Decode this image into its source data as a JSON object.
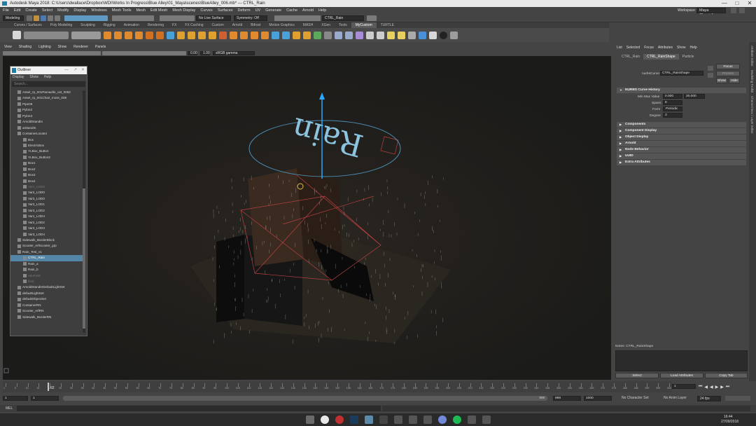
{
  "titlebar": {
    "title": "Autodesk Maya 2018: C:\\Users\\dwallace\\Dropbox\\WDI\\Works In Progress\\Blue Alley\\01_Maya\\scenes\\BlueAlley_006.mb* --- CTRL_Rain",
    "minimize": "—",
    "maximize": "□",
    "close": "✕"
  },
  "menubar": [
    "File",
    "Edit",
    "Create",
    "Select",
    "Modify",
    "Display",
    "Windows",
    "Mesh Tools",
    "Mesh",
    "Edit Mesh",
    "Mesh Display",
    "Curves",
    "Surfaces",
    "Deform",
    "UV",
    "Generate",
    "Cache",
    "Arnold",
    "Help"
  ],
  "workspace": {
    "label": "Workspace :",
    "value": "Maya Classic*"
  },
  "statusline": {
    "mode": "Modeling",
    "live_surface": "No Live Surface",
    "symmetry": "Symmetry: Off",
    "object_field": "CTRL_Rain"
  },
  "shelf_tabs": [
    "Curves / Surfaces",
    "Poly Modeling",
    "Sculpting",
    "Rigging",
    "Animation",
    "Rendering",
    "FX",
    "FX Caching",
    "Custom",
    "Arnold",
    "Bifrost",
    "Motion Graphics",
    "MASH",
    "XGen",
    "Tools",
    "MyCustom",
    "TURTLE"
  ],
  "shelf_active": "MyCustom",
  "panel_menu": [
    "View",
    "Shading",
    "Lighting",
    "Show",
    "Renderer",
    "Panels"
  ],
  "panel_icons": {
    "value1": "0.00",
    "value2": "1.00",
    "colorspace": "sRGB gamma"
  },
  "outliner": {
    "title": "Outliner",
    "menu": [
      "Display",
      "Show",
      "Help"
    ],
    "search_placeholder": "Search...",
    "items": [
      {
        "label": "Asset_rp_001Pamaelle_ost_0082",
        "indent": 1,
        "state": "normal"
      },
      {
        "label": "Asset_rp_001Chair_moss_008",
        "indent": 1,
        "state": "normal"
      },
      {
        "label": "Pipe06",
        "indent": 1,
        "state": "normal"
      },
      {
        "label": "Pylon2",
        "indent": 1,
        "state": "normal"
      },
      {
        "label": "Pylon3",
        "indent": 1,
        "state": "normal"
      },
      {
        "label": "ArnoldStandIn",
        "indent": 1,
        "state": "normal"
      },
      {
        "label": "aiStandIn",
        "indent": 1,
        "state": "normal"
      },
      {
        "label": "ContainerLocator",
        "indent": 1,
        "state": "normal"
      },
      {
        "label": "Box",
        "indent": 2,
        "state": "normal"
      },
      {
        "label": "ElectricBox",
        "indent": 2,
        "state": "normal"
      },
      {
        "label": "YLBox_Button",
        "indent": 2,
        "state": "normal"
      },
      {
        "label": "YLBox_Button2",
        "indent": 2,
        "state": "normal"
      },
      {
        "label": "Box1",
        "indent": 2,
        "state": "normal"
      },
      {
        "label": "Box2",
        "indent": 2,
        "state": "normal"
      },
      {
        "label": "Box3",
        "indent": 2,
        "state": "normal"
      },
      {
        "label": "Box4",
        "indent": 2,
        "state": "normal"
      },
      {
        "label": "Var1_LOD0",
        "indent": 2,
        "state": "dim"
      },
      {
        "label": "Var2_LOD0",
        "indent": 2,
        "state": "normal"
      },
      {
        "label": "Var3_LOD0",
        "indent": 2,
        "state": "normal"
      },
      {
        "label": "Var2_LOD1",
        "indent": 2,
        "state": "normal"
      },
      {
        "label": "Var3_LOD2",
        "indent": 2,
        "state": "normal"
      },
      {
        "label": "Var1_LOD4",
        "indent": 2,
        "state": "normal"
      },
      {
        "label": "Var2_LOD2",
        "indent": 2,
        "state": "normal"
      },
      {
        "label": "Var3_LOD3",
        "indent": 2,
        "state": "normal"
      },
      {
        "label": "Var3_LOD4",
        "indent": 2,
        "state": "normal"
      },
      {
        "label": "Sidewalk_BorderBlock",
        "indent": 1,
        "state": "normal"
      },
      {
        "label": "Scooter_refScooter_grp",
        "indent": 1,
        "state": "normal"
      },
      {
        "label": "Rain_Test_v1",
        "indent": 1,
        "state": "normal"
      },
      {
        "label": "CTRL_Rain",
        "indent": 2,
        "state": "selected"
      },
      {
        "label": "Rain_a",
        "indent": 2,
        "state": "normal"
      },
      {
        "label": "Rain_b",
        "indent": 2,
        "state": "normal"
      },
      {
        "label": "rainField",
        "indent": 2,
        "state": "dim"
      },
      {
        "label": "field",
        "indent": 2,
        "state": "dim"
      },
      {
        "label": "ArnoldStandInDefaultLightSet",
        "indent": 1,
        "state": "normal"
      },
      {
        "label": "defaultLightSet",
        "indent": 1,
        "state": "normal"
      },
      {
        "label": "defaultObjectSet",
        "indent": 1,
        "state": "normal"
      },
      {
        "label": "ContainerRN",
        "indent": 1,
        "state": "normal"
      },
      {
        "label": "Scooter_refRN",
        "indent": 1,
        "state": "normal"
      },
      {
        "label": "Sidewalk_BorderRN",
        "indent": 1,
        "state": "normal"
      }
    ]
  },
  "viewport": {
    "curve_text": "Rain",
    "accent": "#b84040"
  },
  "attribute_editor": {
    "menu": [
      "List",
      "Selected",
      "Focus",
      "Attributes",
      "Show",
      "Help"
    ],
    "tabs": [
      "CTRL_Rain",
      "CTRL_RainShape",
      "Particle"
    ],
    "active_tab": "CTRL_RainShape",
    "node_label": "nurbsCurve:",
    "node_value": "CTRL_RainShape",
    "focus_btn": "Focus",
    "presets_btn": "Presets",
    "show_btn": "Show",
    "hide_btn": "Hide",
    "section_history": "NURBS Curve History",
    "min_max_label": "Min Max Value",
    "min_value": "0.000",
    "max_value": "20.000",
    "spans_label": "Spans",
    "spans_value": "8",
    "form_label": "Form",
    "form_value": "Periodic",
    "degree_label": "Degree",
    "degree_value": "3",
    "sections": [
      "Components",
      "Component Display",
      "Object Display",
      "Arnold",
      "Node Behavior",
      "UUID",
      "Extra Attributes"
    ],
    "notes_label": "Notes: CTRL_RainShape",
    "select_btn": "Select",
    "load_btn": "Load Attributes",
    "copy_btn": "Copy Tab"
  },
  "right_tabs": [
    "Attribute Editor",
    "Modeling Toolkit",
    "Channel Box / Layer Editor"
  ],
  "timeline": {
    "ticks": [
      "1",
      "5",
      "10",
      "15",
      "20",
      "25",
      "30",
      "35",
      "40",
      "45",
      "50",
      "55",
      "60",
      "65",
      "70",
      "75",
      "80",
      "85",
      "90",
      "95",
      "100",
      "105",
      "110",
      "115",
      "120",
      "125",
      "130",
      "135",
      "140",
      "145",
      "150",
      "155",
      "160",
      "165",
      "170",
      "175",
      "180",
      "185",
      "190",
      "195",
      "200",
      "205",
      "210",
      "215",
      "220",
      "225",
      "230",
      "235",
      "240",
      "245",
      "250",
      "255",
      "260",
      "265",
      "270",
      "275",
      "280",
      "285",
      "290",
      "295",
      "300"
    ],
    "current_frame": "1",
    "start": "1",
    "range_start": "1",
    "range_end": "998",
    "end": "998",
    "end2": "1000",
    "char_set": "No Character Set",
    "anim_layer": "No Anim Layer",
    "fps": "24 fps",
    "playhead": "62"
  },
  "command_line": {
    "label": "MEL"
  },
  "taskbar": {
    "time": "16:44",
    "date": "27/09/2018"
  }
}
